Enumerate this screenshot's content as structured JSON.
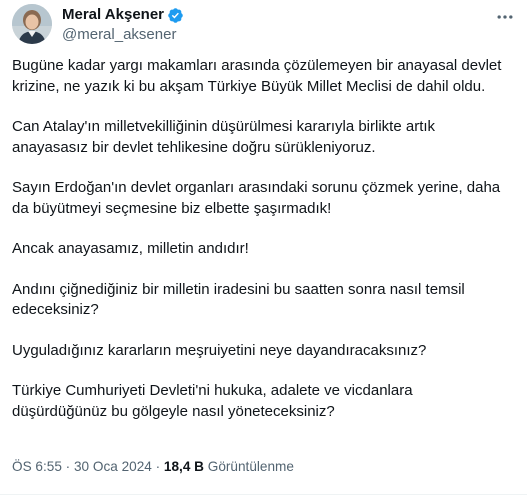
{
  "author": {
    "name": "Meral Akşener",
    "handle": "@meral_aksener",
    "verified": true
  },
  "paragraphs": [
    "Bugüne kadar yargı makamları arasında çözülemeyen bir anayasal devlet\nkrizine, ne yazık ki bu akşam Türkiye Büyük Millet Meclisi de dahil oldu.",
    "Can Atalay'ın milletvekilliğinin düşürülmesi kararıyla birlikte artık\nanayasasız bir devlet tehlikesine doğru sürükleniyoruz.",
    "Sayın Erdoğan'ın devlet organları arasındaki sorunu çözmek yerine, daha\nda büyütmeyi seçmesine biz elbette şaşırmadık!",
    "Ancak anayasamız, milletin andıdır!",
    "Andını çiğnediğiniz bir milletin iradesini bu saatten sonra nasıl temsil\nedeceksiniz?",
    "Uyguladığınız kararların meşruiyetini neye dayandıracaksınız?",
    "Türkiye Cumhuriyeti Devleti'ni hukuka, adalete ve vicdanlara\ndüşürdüğünüz bu gölgeyle nasıl yöneteceksiniz?"
  ],
  "meta": {
    "time": "ÖS 6:55",
    "separator": "·",
    "date": "30 Oca 2024",
    "views_count": "18,4 B",
    "views_label": "Görüntülenme"
  },
  "icons": {
    "verified": "verified-badge-icon",
    "more": "more-options-icon"
  },
  "colors": {
    "text": "#0f1419",
    "secondary": "#536471",
    "verified": "#1d9bf0"
  }
}
